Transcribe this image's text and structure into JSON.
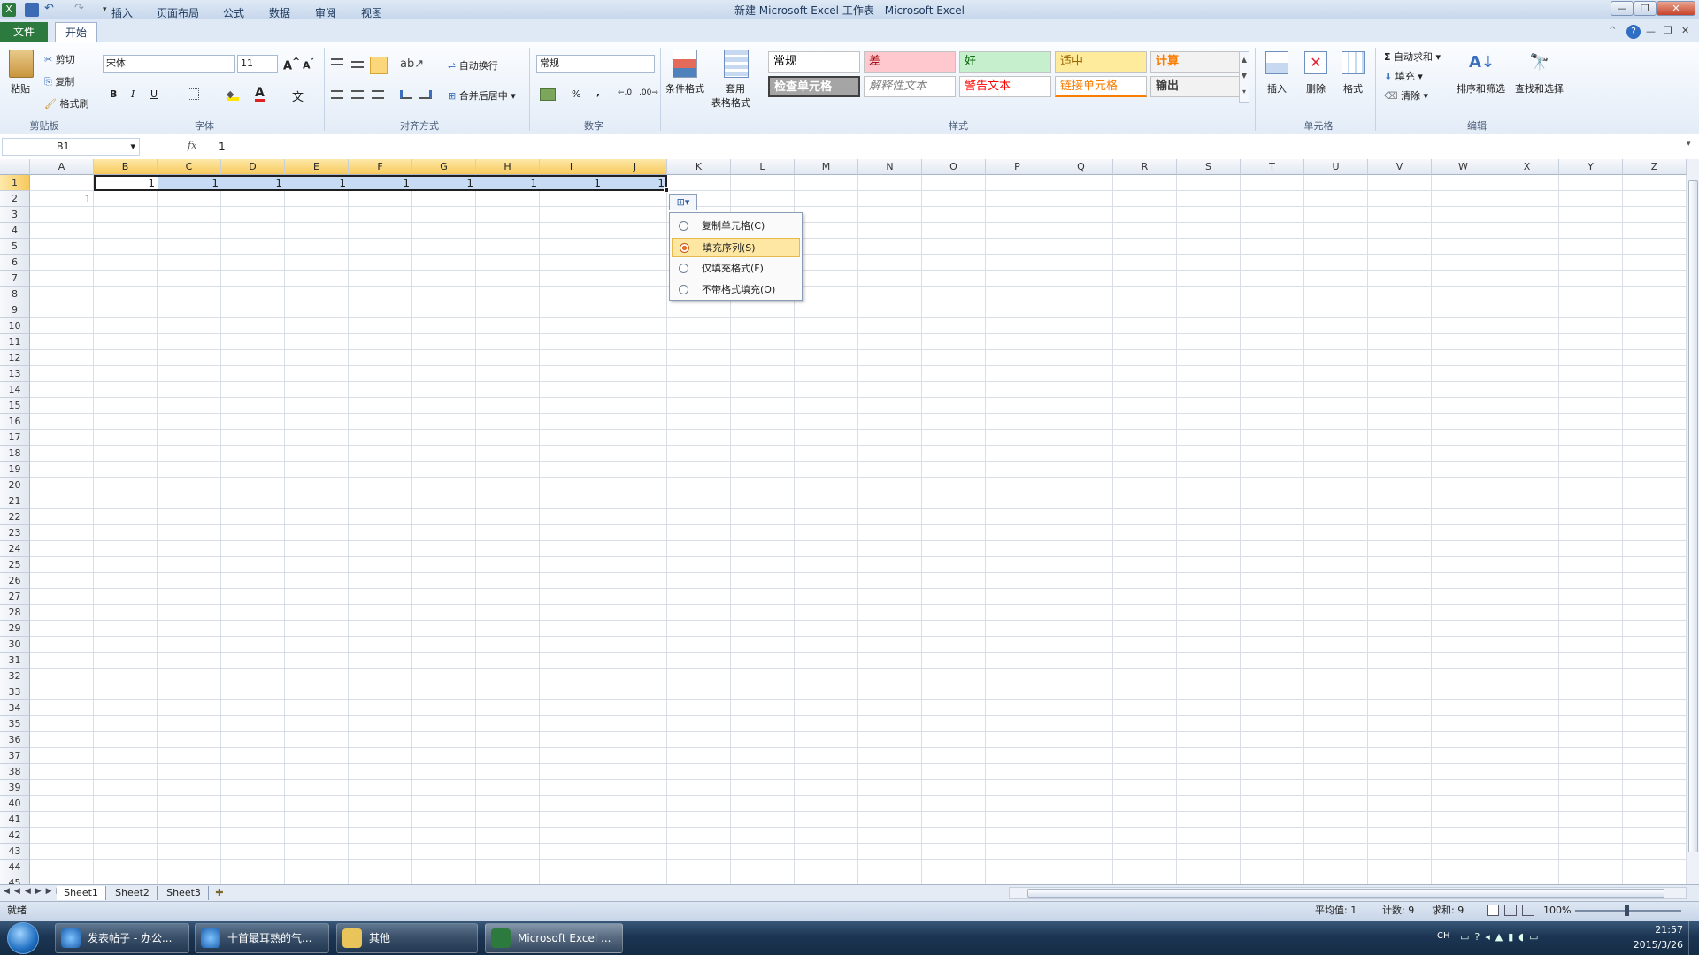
{
  "window": {
    "title": "新建 Microsoft Excel 工作表 - Microsoft Excel"
  },
  "tabs": {
    "file": "文件",
    "home": "开始",
    "insert": "插入",
    "page_layout": "页面布局",
    "formulas": "公式",
    "data": "数据",
    "review": "审阅",
    "view": "视图"
  },
  "ribbon": {
    "clipboard": {
      "paste": "粘贴",
      "cut": "剪切",
      "copy": "复制",
      "format_painter": "格式刷",
      "label": "剪贴板"
    },
    "font": {
      "name": "宋体",
      "size": "11",
      "bold": "B",
      "italic": "I",
      "underline": "U",
      "label": "字体"
    },
    "alignment": {
      "wrap": "自动换行",
      "merge": "合并后居中",
      "label": "对齐方式"
    },
    "number": {
      "format": "常规",
      "percent": "%",
      "comma": ",",
      "label": "数字"
    },
    "styles": {
      "conditional": "条件格式",
      "table_format_1": "套用",
      "table_format_2": "表格格式",
      "label": "样式",
      "cells": [
        {
          "text": "常规",
          "bg": "#ffffff",
          "fg": "#000000"
        },
        {
          "text": "差",
          "bg": "#ffc7ce",
          "fg": "#9c0006"
        },
        {
          "text": "好",
          "bg": "#c6efce",
          "fg": "#006100"
        },
        {
          "text": "适中",
          "bg": "#ffeb9c",
          "fg": "#9c6500"
        },
        {
          "text": "计算",
          "bg": "#f2f2f2",
          "fg": "#fa7d00"
        },
        {
          "text": "检查单元格",
          "bg": "#a5a5a5",
          "fg": "#ffffff"
        },
        {
          "text": "解释性文本",
          "bg": "#ffffff",
          "fg": "#7f7f7f"
        },
        {
          "text": "警告文本",
          "bg": "#ffffff",
          "fg": "#ff0000"
        },
        {
          "text": "链接单元格",
          "bg": "#ffffff",
          "fg": "#fa7d00"
        },
        {
          "text": "输出",
          "bg": "#f2f2f2",
          "fg": "#3f3f3f"
        }
      ]
    },
    "cells": {
      "insert": "插入",
      "delete": "删除",
      "format": "格式",
      "label": "单元格"
    },
    "editing": {
      "autosum": "自动求和",
      "fill": "填充",
      "clear": "清除",
      "sort": "排序和筛选",
      "find": "查找和选择",
      "label": "编辑"
    }
  },
  "formula_bar": {
    "name_box": "B1",
    "fx": "fx",
    "value": "1"
  },
  "grid": {
    "columns": [
      "A",
      "B",
      "C",
      "D",
      "E",
      "F",
      "G",
      "H",
      "I",
      "J",
      "K",
      "L",
      "M",
      "N",
      "O",
      "P",
      "Q",
      "R",
      "S",
      "T",
      "U",
      "V",
      "W",
      "X",
      "Y",
      "Z"
    ],
    "row_numbers": [
      "1",
      "2",
      "3",
      "4",
      "5",
      "6",
      "7",
      "8",
      "9",
      "10",
      "11",
      "12",
      "13",
      "14",
      "15",
      "16",
      "17",
      "18",
      "19",
      "20",
      "21",
      "22",
      "23",
      "24",
      "25",
      "26",
      "27",
      "28",
      "29",
      "30",
      "31",
      "32",
      "33",
      "34",
      "35",
      "36",
      "37",
      "38",
      "39",
      "40",
      "41",
      "42",
      "43",
      "44",
      "45"
    ],
    "row1_values": [
      "1",
      "1",
      "1",
      "1",
      "1",
      "1",
      "1",
      "1",
      "1"
    ],
    "a2_value": "1"
  },
  "autofill_menu": {
    "items": [
      {
        "label": "复制单元格(C)",
        "selected": false
      },
      {
        "label": "填充序列(S)",
        "selected": true
      },
      {
        "label": "仅填充格式(F)",
        "selected": false
      },
      {
        "label": "不带格式填充(O)",
        "selected": false
      }
    ]
  },
  "sheets": [
    "Sheet1",
    "Sheet2",
    "Sheet3"
  ],
  "status": {
    "ready": "就绪",
    "average": "平均值: 1",
    "count": "计数: 9",
    "sum": "求和: 9",
    "zoom": "100%"
  },
  "taskbar": {
    "items": [
      "发表帖子 - 办公...",
      "十首最耳熟的气...",
      "其他",
      "Microsoft Excel ..."
    ],
    "lang": "CH",
    "time": "21:57",
    "date": "2015/3/26"
  }
}
